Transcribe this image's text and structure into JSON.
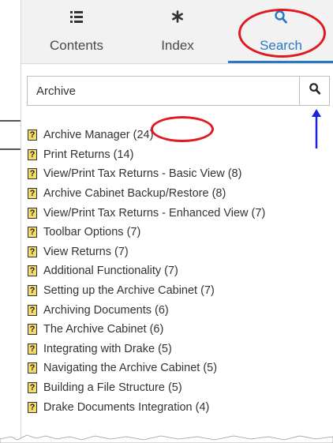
{
  "tabs": [
    {
      "label": "Contents",
      "icon": "list-icon"
    },
    {
      "label": "Index",
      "icon": "asterisk-icon"
    },
    {
      "label": "Search",
      "icon": "search-icon"
    }
  ],
  "active_tab": "Search",
  "search": {
    "value": "Archive"
  },
  "results": [
    {
      "title": "Archive Manager (24)"
    },
    {
      "title": "Print Returns (14)"
    },
    {
      "title": "View/Print Tax Returns - Basic View (8)"
    },
    {
      "title": "Archive Cabinet Backup/Restore (8)"
    },
    {
      "title": "View/Print Tax Returns - Enhanced View (7)"
    },
    {
      "title": "Toolbar Options (7)"
    },
    {
      "title": "View Returns (7)"
    },
    {
      "title": "Additional Functionality (7)"
    },
    {
      "title": "Setting up the Archive Cabinet (7)"
    },
    {
      "title": "Archiving Documents (6)"
    },
    {
      "title": "The Archive Cabinet (6)"
    },
    {
      "title": "Integrating with Drake (5)"
    },
    {
      "title": "Navigating the Archive Cabinet (5)"
    },
    {
      "title": "Building a File Structure (5)"
    },
    {
      "title": "Drake Documents Integration (4)"
    }
  ],
  "colors": {
    "accent": "#2a78c5",
    "annotation": "#e01a22",
    "arrow": "#1a23d8"
  }
}
